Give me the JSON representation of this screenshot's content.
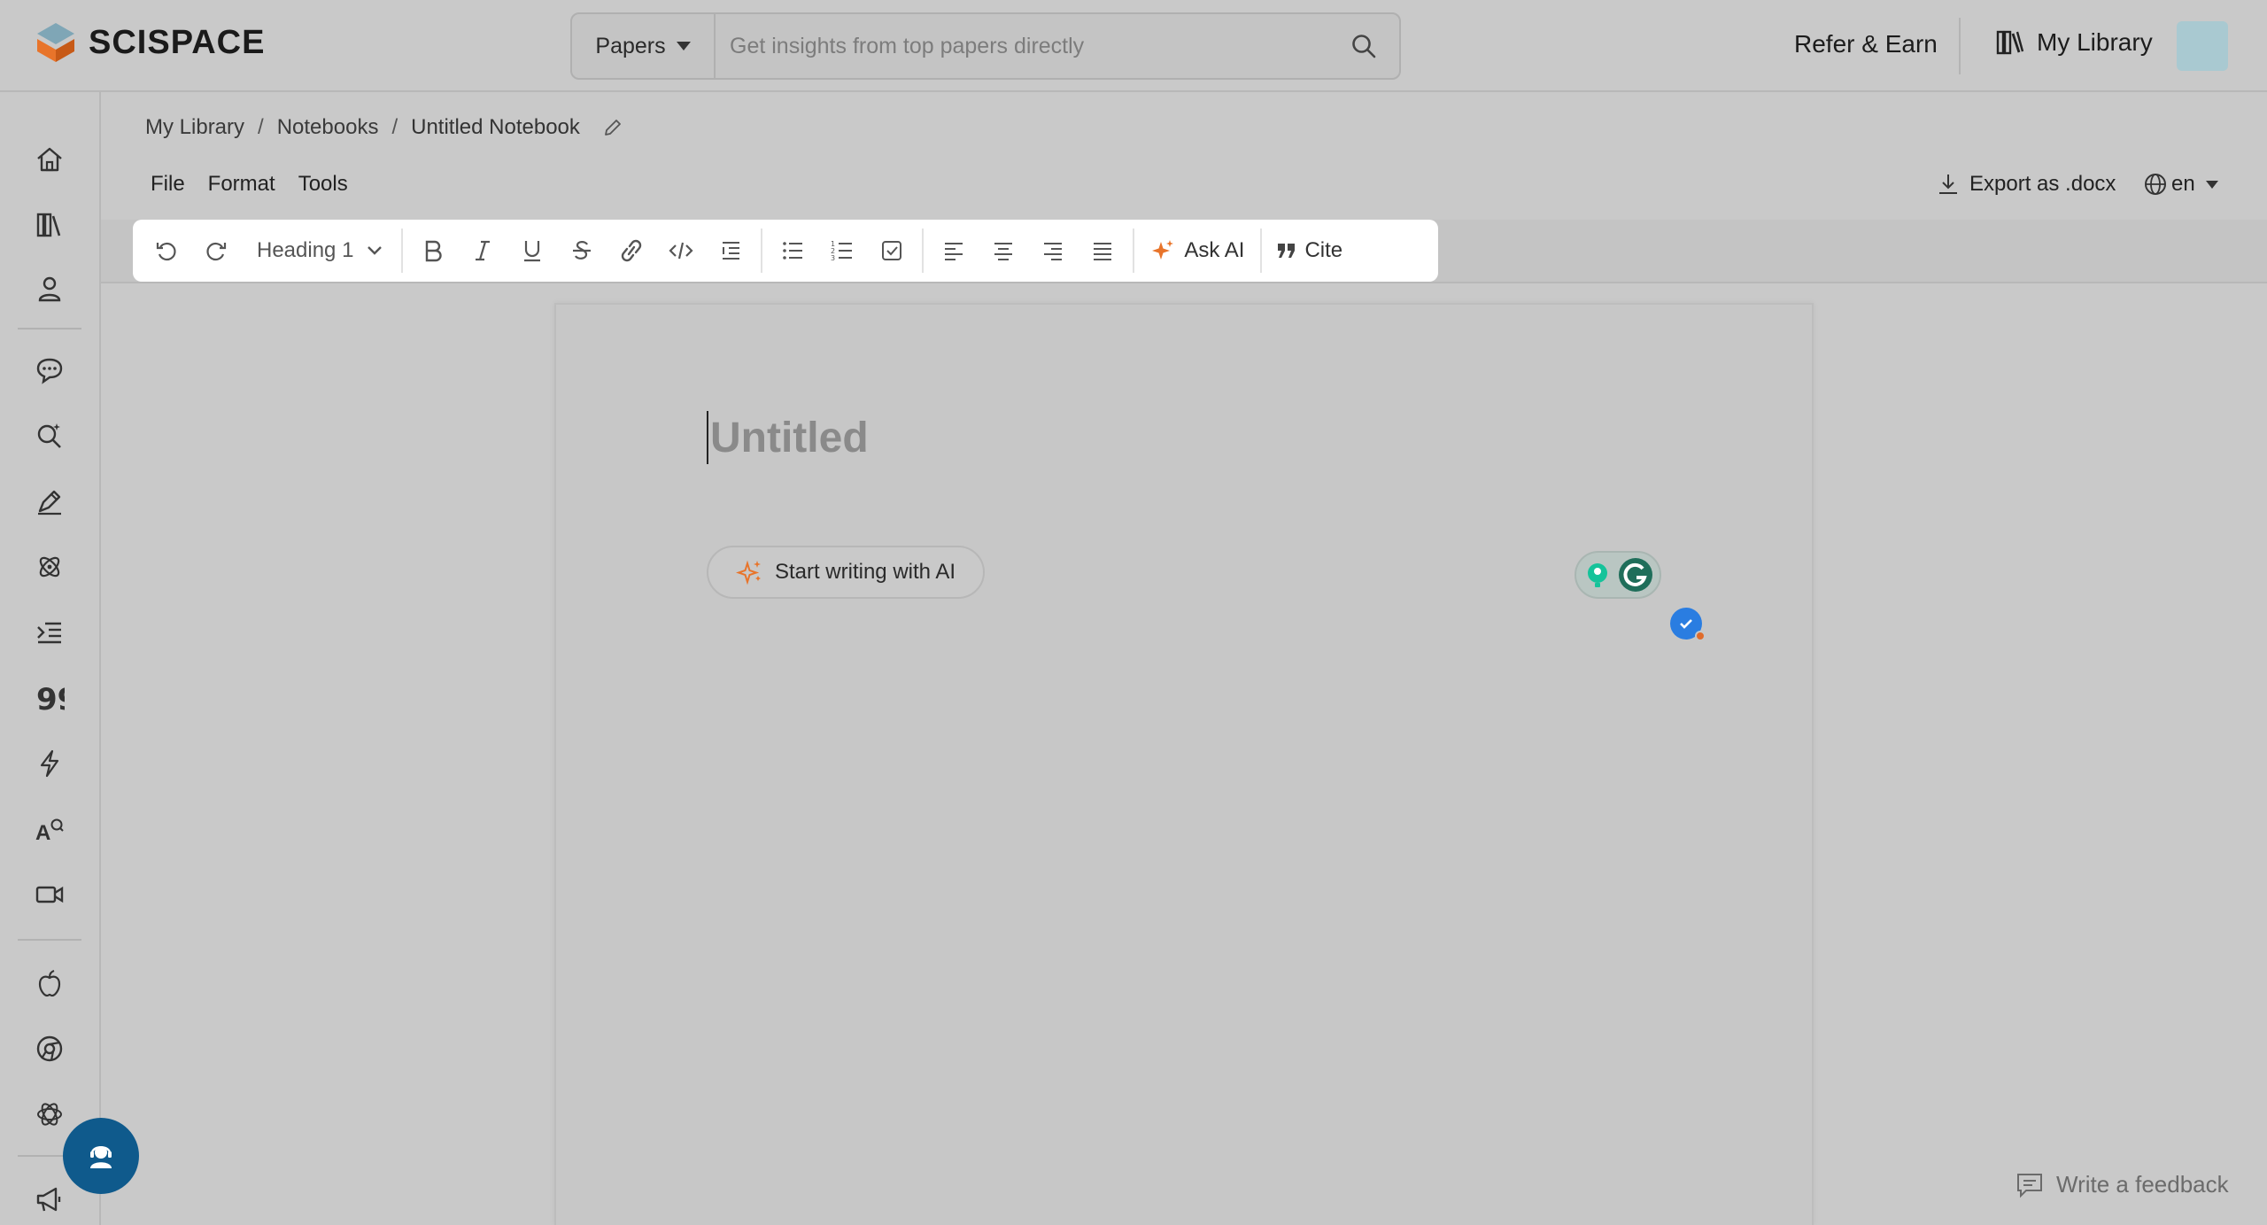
{
  "header": {
    "brand": "SCISPACE",
    "search": {
      "type_label": "Papers",
      "placeholder": "Get insights from top papers directly"
    },
    "refer_label": "Refer & Earn",
    "library_label": "My Library"
  },
  "sidebar": {
    "icons": [
      "home-icon",
      "library-icon",
      "profile-icon",
      "chat-pdf-icon",
      "literature-search-icon",
      "ai-writer-icon",
      "extract-data-icon",
      "paraphraser-icon",
      "citation-generator-icon",
      "ai-detector-icon",
      "translator-icon",
      "video-icon",
      "apple-app-icon",
      "chrome-extension-icon",
      "chatgpt-plugin-icon",
      "announcements-icon"
    ]
  },
  "breadcrumb": {
    "items": [
      "My Library",
      "Notebooks"
    ],
    "current": "Untitled Notebook"
  },
  "menu": {
    "file": "File",
    "format": "Format",
    "tools": "Tools"
  },
  "actions": {
    "export_label": "Export as .docx",
    "language": "en"
  },
  "toolbar": {
    "heading": "Heading 1",
    "ask_ai": "Ask AI",
    "cite": "Cite"
  },
  "document": {
    "title_placeholder": "Untitled",
    "ai_prompt": "Start writing with AI"
  },
  "footer": {
    "feedback": "Write a feedback"
  },
  "colors": {
    "accent_orange": "#e8742a",
    "support_blue": "#0f5a8c",
    "grammarly_green": "#15c39a",
    "check_blue": "#2a7de1"
  }
}
